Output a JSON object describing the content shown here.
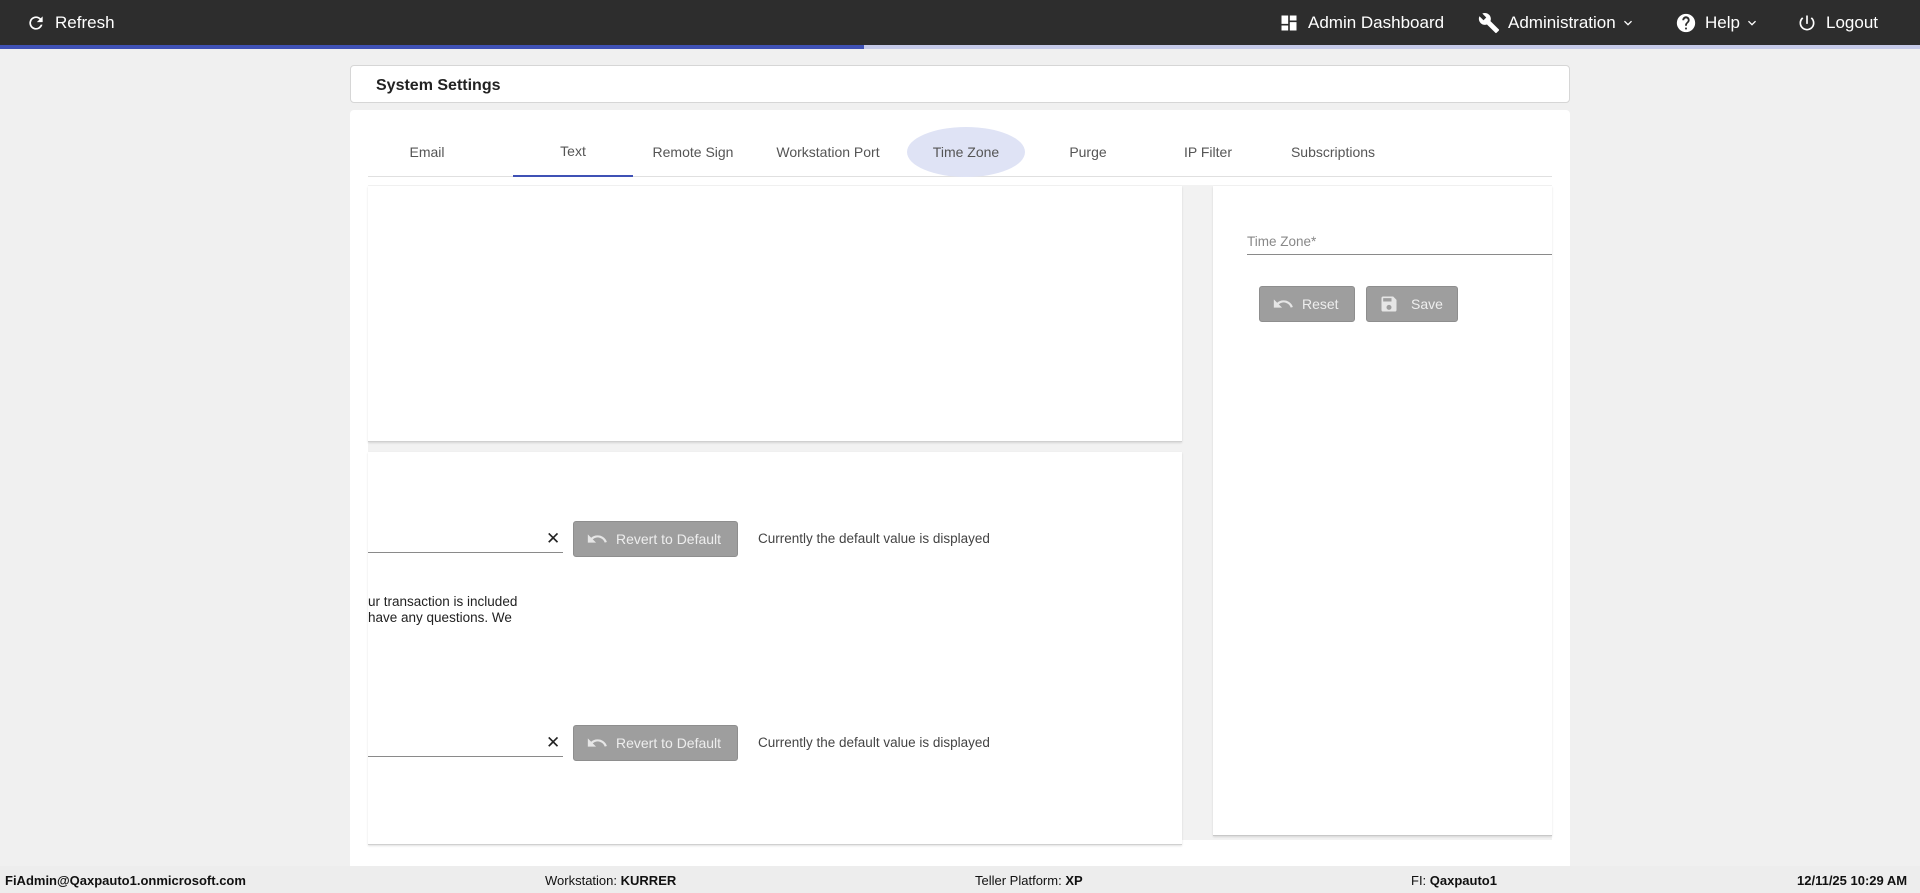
{
  "topbar": {
    "refresh_label": "Refresh",
    "admin_dashboard_label": "Admin Dashboard",
    "administration_label": "Administration",
    "help_label": "Help",
    "logout_label": "Logout"
  },
  "progress": {
    "fraction": 0.45
  },
  "page": {
    "title": "System Settings"
  },
  "tabs": [
    {
      "label": "Email"
    },
    {
      "label": "Text"
    },
    {
      "label": "Remote Sign"
    },
    {
      "label": "Workstation Port"
    },
    {
      "label": "Time Zone"
    },
    {
      "label": "Purge"
    },
    {
      "label": "IP Filter"
    },
    {
      "label": "Subscriptions"
    }
  ],
  "text_settings": {
    "row1": {
      "revert_label": "Revert to Default",
      "status": "Currently the default value is displayed"
    },
    "snippet_line1": "ur transaction is included",
    "snippet_line2": "have any questions. We",
    "row2": {
      "revert_label": "Revert to Default",
      "status": "Currently the default value is displayed"
    }
  },
  "time_zone": {
    "label": "Time Zone*",
    "reset_label": "Reset",
    "save_label": "Save"
  },
  "footer": {
    "user": "FiAdmin@Qaxpauto1.onmicrosoft.com",
    "workstation_label": "Workstation:",
    "workstation_value": "KURRER",
    "platform_label": "Teller Platform:",
    "platform_value": "XP",
    "fi_label": "FI:",
    "fi_value": "Qaxpauto1",
    "datetime": "12/11/25 10:29 AM"
  },
  "colors": {
    "accent": "#3f51b5",
    "topbar": "#2d2d2d",
    "button": "#9e9e9e"
  },
  "icons": [
    "refresh-icon",
    "dashboard-icon",
    "wrench-icon",
    "help-icon",
    "power-icon",
    "chevron-down-icon",
    "undo-icon",
    "save-icon",
    "close-icon"
  ]
}
